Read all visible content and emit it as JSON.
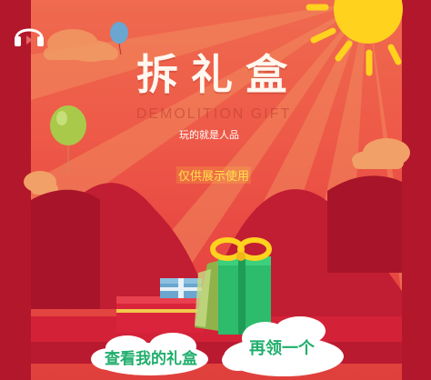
{
  "header": {
    "title": "拆礼盒",
    "subtitle_en": "DEMOLITION GIFT",
    "slogan": "玩的就是人品"
  },
  "watermark": "仅供展示使用",
  "icons": {
    "audio": "headphones-icon"
  },
  "buttons": {
    "view_gift": "查看我的礼盒",
    "again": "再领一个"
  },
  "colors": {
    "background": "#b0152a",
    "sky_top": "#ef6a4f",
    "sun": "#ffd21e",
    "button_text": "#1fae6c",
    "gift_green": "#2dbb6c",
    "gift_red": "#d9243b"
  }
}
